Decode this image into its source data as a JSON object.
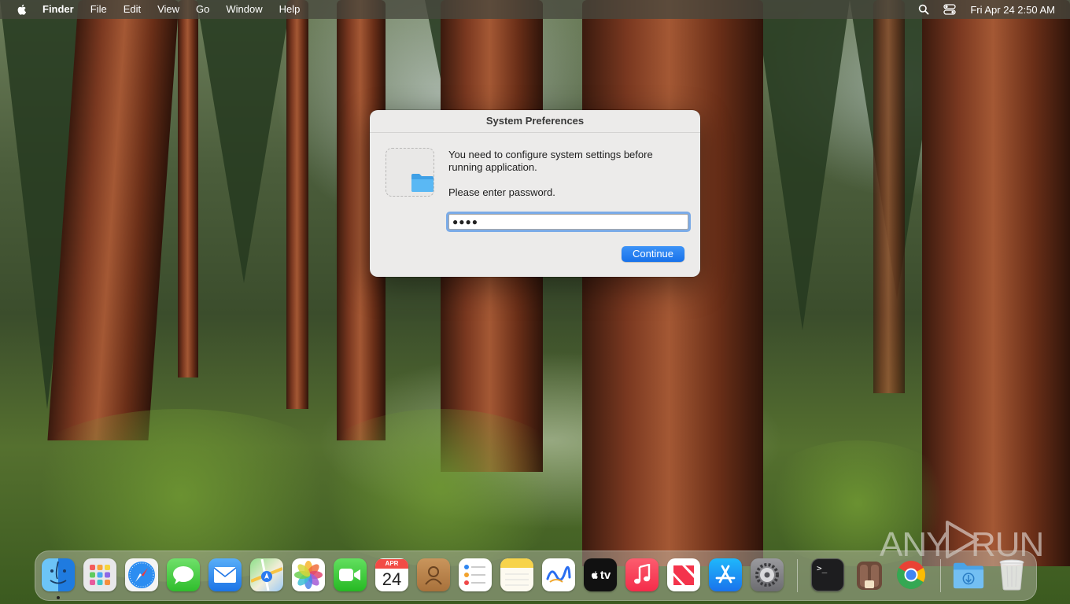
{
  "menubar": {
    "apple_icon": "apple-icon",
    "items": [
      "Finder",
      "File",
      "Edit",
      "View",
      "Go",
      "Window",
      "Help"
    ],
    "status_icons": [
      "search-icon",
      "control-center-icon"
    ],
    "clock": "Fri Apr 24  2:50 AM"
  },
  "dialog": {
    "title": "System Preferences",
    "icon": "folder-icon",
    "message": "You need to configure system settings before running application.",
    "prompt": "Please enter password.",
    "password_value": "●●●●",
    "continue_label": "Continue",
    "accent_color": "#1f7aec"
  },
  "dock": {
    "apps": [
      {
        "name": "Finder",
        "icon": "finder-icon",
        "running": true
      },
      {
        "name": "Launchpad",
        "icon": "launchpad-icon"
      },
      {
        "name": "Safari",
        "icon": "safari-icon"
      },
      {
        "name": "Messages",
        "icon": "messages-icon"
      },
      {
        "name": "Mail",
        "icon": "mail-icon"
      },
      {
        "name": "Maps",
        "icon": "maps-icon"
      },
      {
        "name": "Photos",
        "icon": "photos-icon"
      },
      {
        "name": "FaceTime",
        "icon": "facetime-icon"
      },
      {
        "name": "Calendar",
        "icon": "calendar-icon",
        "month": "APR",
        "day": "24"
      },
      {
        "name": "Contacts",
        "icon": "contacts-icon"
      },
      {
        "name": "Reminders",
        "icon": "reminders-icon"
      },
      {
        "name": "Notes",
        "icon": "notes-icon"
      },
      {
        "name": "Freeform",
        "icon": "freeform-icon"
      },
      {
        "name": "TV",
        "icon": "tv-icon",
        "label": "tv"
      },
      {
        "name": "Music",
        "icon": "music-icon"
      },
      {
        "name": "News",
        "icon": "news-icon"
      },
      {
        "name": "App Store",
        "icon": "app-store-icon"
      },
      {
        "name": "System Settings",
        "icon": "system-settings-icon"
      },
      {
        "name": "Terminal",
        "icon": "terminal-icon",
        "label": ">_"
      },
      {
        "name": "Unknown App",
        "icon": "app-icon"
      },
      {
        "name": "Google Chrome",
        "icon": "chrome-icon"
      },
      {
        "name": "Downloads",
        "icon": "downloads-folder-icon"
      },
      {
        "name": "Trash",
        "icon": "trash-icon"
      }
    ]
  },
  "watermark": {
    "text_left": "ANY",
    "text_right": "RUN"
  }
}
